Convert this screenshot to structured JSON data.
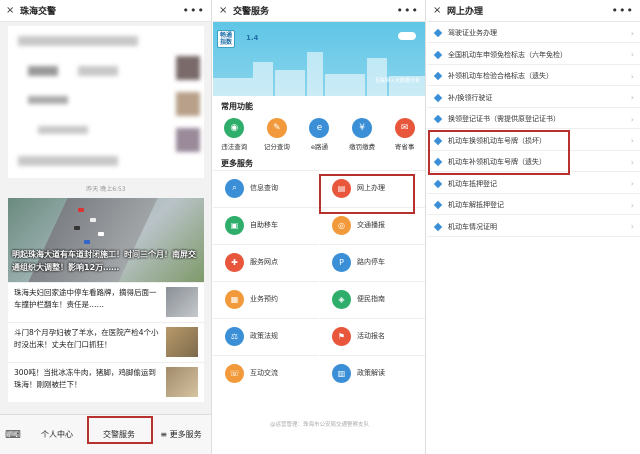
{
  "panel1": {
    "title": "珠海交警",
    "close_icon": "×",
    "more_icon": "•••",
    "timestamp": "昨天 晚上6:53",
    "hero_caption": "明起珠海大道有车道封闭施工！时间三个月！南屏交通组织大调整！影响12万……",
    "news": [
      {
        "text": "珠海夫妇回家途中停车看路牌，摘得后面一车撞护栏翻车！责任是……"
      },
      {
        "text": "斗门8个月孕妇被了羊水，在医院产检4个小时没出来！丈夫在门口抓狂！"
      },
      {
        "text": "300吨！当批冰冻牛肉，猪脚，鸡脚偷运到珠海！刚刚被拦下！"
      }
    ],
    "bottom_menu": [
      "个人中心",
      "交警服务",
      "≡ 更多服务"
    ],
    "highlight_color": "#b8312f"
  },
  "panel2": {
    "title": "交警服务",
    "banner_badge": "畅通\n指数",
    "banner_value": "1.4",
    "banner_logo": "互联网＋大数据分析",
    "common_title": "常用功能",
    "quick": [
      {
        "label": "违法查询",
        "icon": "camera-icon",
        "color": "#2fae6b"
      },
      {
        "label": "记分查询",
        "icon": "score-icon",
        "color": "#f29a3b"
      },
      {
        "label": "e路通",
        "icon": "e-icon",
        "color": "#3a8fd6"
      },
      {
        "label": "缴罚缴费",
        "icon": "pay-icon",
        "color": "#3a8fd6"
      },
      {
        "label": "寄省事",
        "icon": "mail-icon",
        "color": "#e8563c"
      }
    ],
    "more_title": "更多服务",
    "services": [
      {
        "label": "信息查询",
        "icon": "search-icon",
        "color": "#3a8fd6"
      },
      {
        "label": "网上办理",
        "icon": "online-icon",
        "color": "#e8563c"
      },
      {
        "label": "自助移车",
        "icon": "car-icon",
        "color": "#2fae6b"
      },
      {
        "label": "交通播报",
        "icon": "radio-icon",
        "color": "#f29a3b"
      },
      {
        "label": "服务网点",
        "icon": "location-icon",
        "color": "#e8563c"
      },
      {
        "label": "路内停车",
        "icon": "parking-icon",
        "color": "#3a8fd6"
      },
      {
        "label": "业务预约",
        "icon": "calendar-icon",
        "color": "#f29a3b"
      },
      {
        "label": "便民指南",
        "icon": "guide-icon",
        "color": "#2fae6b"
      },
      {
        "label": "政策法规",
        "icon": "gavel-icon",
        "color": "#3a8fd6"
      },
      {
        "label": "活动报名",
        "icon": "flag-icon",
        "color": "#e8563c"
      },
      {
        "label": "互动交流",
        "icon": "chat-icon",
        "color": "#f29a3b"
      },
      {
        "label": "政策解读",
        "icon": "book-icon",
        "color": "#3a8fd6"
      }
    ],
    "footer": "@运营管理：珠海市公安局交通警察支队"
  },
  "panel3": {
    "title": "网上办理",
    "items": [
      "驾驶证业务办理",
      "全国机动车申领免检标志（六年免检）",
      "补领机动车检验合格标志（遗失）",
      "补/换领行驶证",
      "换领登记证书（需提供原登记证书）",
      "机动车换领机动车号牌（损坏）",
      "机动车补领机动车号牌（遗失）",
      "机动车抵押登记",
      "机动车解抵押登记",
      "机动车情况证明"
    ]
  }
}
